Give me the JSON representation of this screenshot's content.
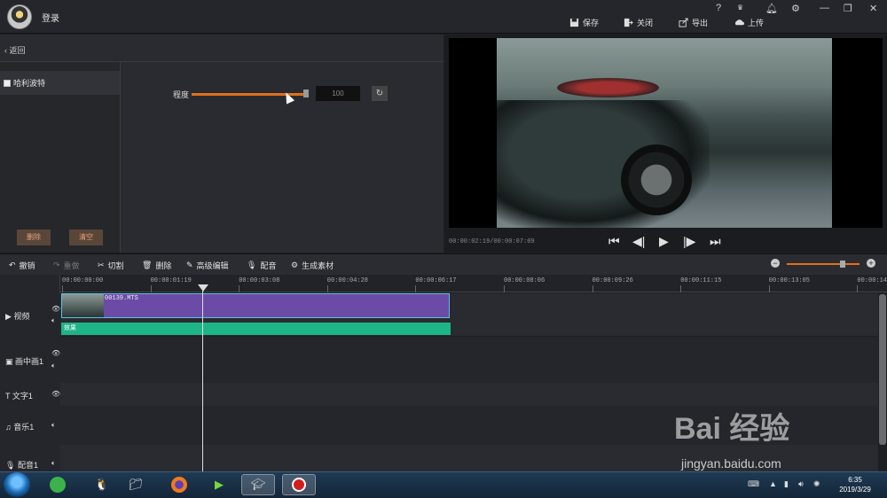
{
  "titlebar": {
    "login": "登录",
    "controls": [
      "?",
      "VIP",
      "bell",
      "gear",
      "min",
      "restore",
      "close"
    ]
  },
  "toolbar": {
    "save": "保存",
    "close": "关闭",
    "export": "导出",
    "upload": "上传"
  },
  "left": {
    "back": "返回",
    "effect_item": "哈利波特",
    "delete": "删除",
    "clear": "清空",
    "degree_label": "程度",
    "degree_value": "100",
    "degree_fraction": 1.0
  },
  "preview": {
    "timecode": "00:00:02:19/00:00:07:09"
  },
  "edit": {
    "undo": "撤销",
    "redo": "重做",
    "cut": "切割",
    "delete": "删除",
    "advanced": "高级编辑",
    "dub": "配音",
    "generate": "生成素材"
  },
  "ruler": [
    "00:00:00:00",
    "00:00:01:19",
    "00:00:03:08",
    "00:00:04:28",
    "00:00:06:17",
    "00:00:08:06",
    "00:00:09:26",
    "00:00:11:15",
    "00:00:13:05",
    "00:00:14:"
  ],
  "tracks": {
    "video": "视频",
    "pip": "画中画1",
    "text": "文字1",
    "music": "音乐1",
    "voice": "配音1"
  },
  "clip": {
    "name": "00139.MTS",
    "fx": "效果"
  },
  "taskbar": {
    "time": "6:35",
    "date": "2019/3/29"
  },
  "watermark": {
    "brand": "Bai  经验",
    "url": "jingyan.baidu.com"
  }
}
